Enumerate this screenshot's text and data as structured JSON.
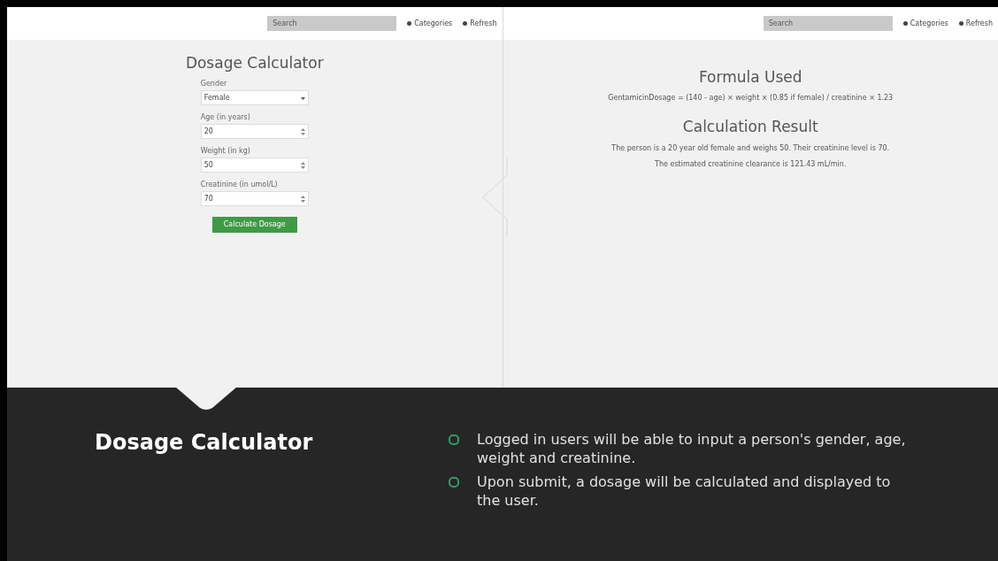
{
  "screens": [
    {
      "nav": {
        "search_placeholder": "Search",
        "links": [
          "Categories",
          "Refresh"
        ]
      },
      "kind": "form",
      "title": "Dosage Calculator",
      "fields": [
        {
          "label": "Gender",
          "kind": "select",
          "value": "Female"
        },
        {
          "label": "Age (in years)",
          "kind": "number",
          "value": "20"
        },
        {
          "label": "Weight (in kg)",
          "kind": "number",
          "value": "50"
        },
        {
          "label": "Creatinine (in umol/L)",
          "kind": "number",
          "value": "70"
        }
      ],
      "button": "Calculate Dosage"
    },
    {
      "nav": {
        "search_placeholder": "Search",
        "links": [
          "Categories",
          "Refresh"
        ]
      },
      "kind": "result",
      "sections": [
        {
          "heading": "Formula Used",
          "lines": [
            "GentamicinDosage = (140 - age) × weight × (0.85 if female) / creatinine × 1.23"
          ]
        },
        {
          "heading": "Calculation Result",
          "lines": [
            "The person is a 20 year old female and weighs 50. Their creatinine level is 70.",
            "The estimated creatinine clearance is 121.43 mL/min."
          ]
        }
      ]
    }
  ],
  "caption": {
    "title": "Dosage Calculator",
    "bullets": [
      "Logged in users will be able to input a person's gender, age, weight and creatinine.",
      "Upon submit, a dosage will be calculated and displayed to the user."
    ]
  }
}
